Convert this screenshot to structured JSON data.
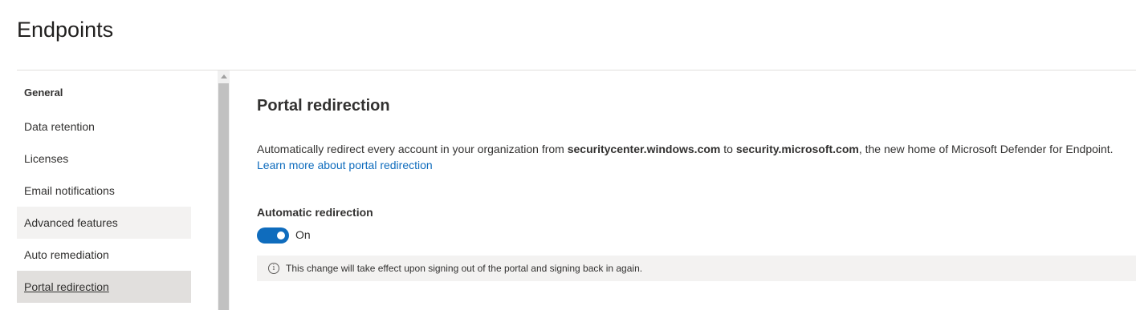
{
  "page": {
    "title": "Endpoints"
  },
  "sidebar": {
    "heading": "General",
    "items": [
      {
        "label": "Data retention"
      },
      {
        "label": "Licenses"
      },
      {
        "label": "Email notifications"
      },
      {
        "label": "Advanced features"
      },
      {
        "label": "Auto remediation"
      },
      {
        "label": "Portal redirection"
      }
    ],
    "selected": "Portal redirection"
  },
  "main": {
    "section_title": "Portal redirection",
    "description": {
      "part1": "Automatically redirect every account in your organization from ",
      "old_domain": "securitycenter.windows.com",
      "part2": " to ",
      "new_domain": "security.microsoft.com",
      "part3": ", the new home of Microsoft Defender for Endpoint.",
      "link": "Learn more about portal redirection"
    },
    "toggle": {
      "label": "Automatic redirection",
      "state": "On",
      "checked": true
    },
    "info_message": "This change will take effect upon signing out of the portal and signing back in again.",
    "info_icon": "info-circle-icon"
  },
  "colors": {
    "accent": "#0f6cbd",
    "selected_bg": "#e1dfdd",
    "hover_bg": "#f3f2f1"
  }
}
